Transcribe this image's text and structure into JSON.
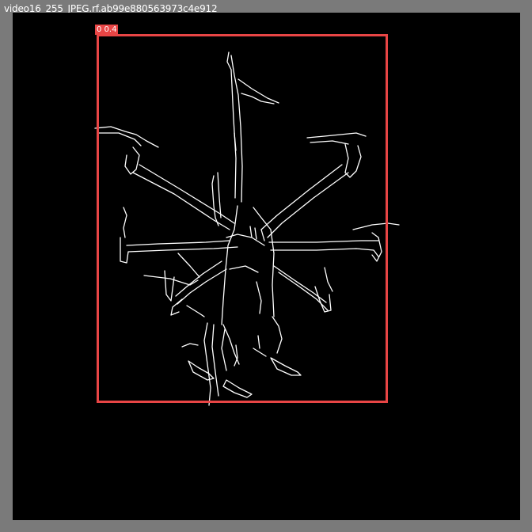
{
  "image": {
    "filename": "video16_255_JPEG.rf.ab99e880563973c4e912"
  },
  "detection": {
    "label": "0 0.4",
    "box_color": "#e84545"
  },
  "colors": {
    "frame": "#7a7a7a",
    "canvas": "#000000",
    "edges": "#ffffff"
  },
  "subject": "edge-detected drone silhouette"
}
